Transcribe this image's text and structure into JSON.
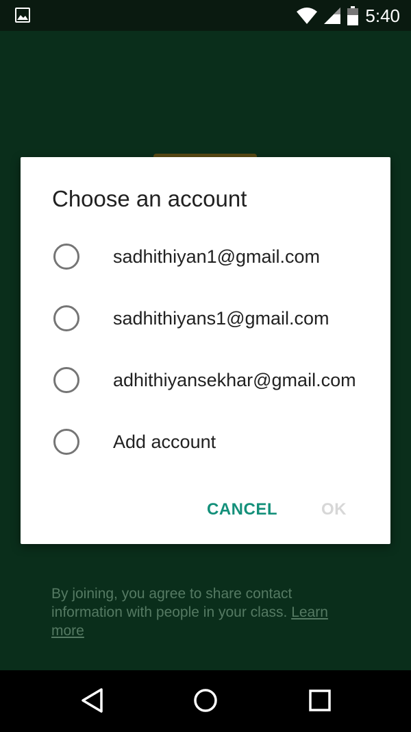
{
  "status_bar": {
    "time": "5:40",
    "icons": [
      "image-notification-icon",
      "wifi-icon",
      "cell-signal-icon",
      "battery-icon"
    ]
  },
  "dialog": {
    "title": "Choose an account",
    "options": [
      {
        "label": "sadhithiyan1@gmail.com",
        "selected": false
      },
      {
        "label": "sadhithiyans1@gmail.com",
        "selected": false
      },
      {
        "label": "adhithiyansekhar@gmail.com",
        "selected": false
      },
      {
        "label": "Add account",
        "selected": false
      }
    ],
    "cancel_label": "CANCEL",
    "ok_label": "OK"
  },
  "footer": {
    "text": "By joining, you agree to share contact information with people in your class.",
    "link_label": "Learn more"
  },
  "nav_bar": {
    "icons": [
      "back-icon",
      "home-icon",
      "recents-icon"
    ]
  },
  "colors": {
    "background": "#0a2e1b",
    "accent": "#14907a",
    "disabled": "#d7d7d7"
  }
}
